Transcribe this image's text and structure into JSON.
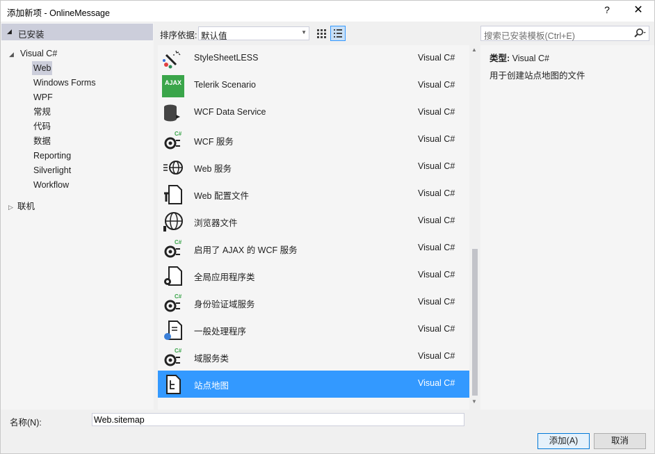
{
  "window": {
    "title": "添加新项 - OnlineMessage",
    "help": "?",
    "close": "✕"
  },
  "tree": {
    "installed_label": "已安装",
    "root_label": "Visual C#",
    "children": [
      "Web",
      "Windows Forms",
      "WPF",
      "常规",
      "代码",
      "数据",
      "Reporting",
      "Silverlight",
      "Workflow"
    ],
    "selected": "Web",
    "online_label": "联机"
  },
  "toolbar": {
    "sort_label": "排序依据:",
    "sort_value": "默认值"
  },
  "search": {
    "placeholder": "搜索已安装模板(Ctrl+E)"
  },
  "templates": [
    {
      "name": "StyleSheetLESS",
      "type": "Visual C#",
      "icon": "less-stylesheet-icon"
    },
    {
      "name": "Telerik Scenario",
      "type": "Visual C#",
      "icon": "ajax-icon",
      "icon_text": "AJAX"
    },
    {
      "name": "WCF Data Service",
      "type": "Visual C#",
      "icon": "data-service-icon"
    },
    {
      "name": "WCF 服务",
      "type": "Visual C#",
      "icon": "wcf-service-icon"
    },
    {
      "name": "Web 服务",
      "type": "Visual C#",
      "icon": "web-service-icon"
    },
    {
      "name": "Web 配置文件",
      "type": "Visual C#",
      "icon": "config-file-icon"
    },
    {
      "name": "浏览器文件",
      "type": "Visual C#",
      "icon": "browser-file-icon"
    },
    {
      "name": "启用了 AJAX 的 WCF 服务",
      "type": "Visual C#",
      "icon": "wcf-service-icon"
    },
    {
      "name": "全局应用程序类",
      "type": "Visual C#",
      "icon": "global-app-class-icon"
    },
    {
      "name": "身份验证域服务",
      "type": "Visual C#",
      "icon": "wcf-service-icon"
    },
    {
      "name": "一般处理程序",
      "type": "Visual C#",
      "icon": "generic-handler-icon"
    },
    {
      "name": "域服务类",
      "type": "Visual C#",
      "icon": "wcf-service-icon"
    },
    {
      "name": "站点地图",
      "type": "Visual C#",
      "icon": "sitemap-icon",
      "selected": true
    }
  ],
  "details": {
    "type_label": "类型:",
    "type_value": "Visual C#",
    "description": "用于创建站点地图的文件"
  },
  "name_field": {
    "label": "名称(N):",
    "value": "Web.sitemap"
  },
  "buttons": {
    "add": "添加(A)",
    "cancel": "取消"
  },
  "colors": {
    "selection": "#3399ff",
    "tree_selection": "#cccedb"
  }
}
